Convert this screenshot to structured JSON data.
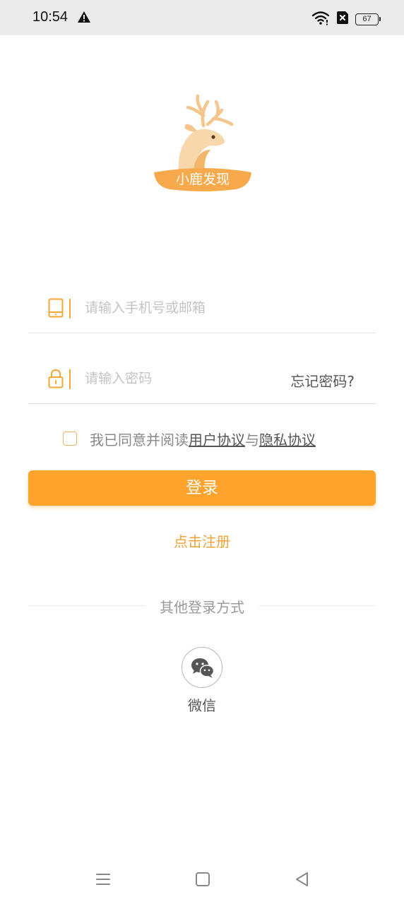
{
  "status_bar": {
    "time": "10:54",
    "battery": "67",
    "icons": [
      "alert-icon",
      "wifi-icon",
      "no-sim-icon",
      "battery-icon"
    ]
  },
  "brand": {
    "logo_text": "小鹿发现",
    "logo_colors": {
      "deer": "#f5c58c",
      "banner": "#f7a94b"
    }
  },
  "login_form": {
    "phone_placeholder": "请输入手机号或邮箱",
    "phone_value": "",
    "password_placeholder": "请输入密码",
    "password_value": "",
    "forgot_label": "忘记密码?",
    "agreement_prefix": "我已同意并阅读",
    "user_agreement": "用户协议",
    "agreement_and": "与",
    "privacy_policy": "隐私协议",
    "agreement_checked": false,
    "login_label": "登录",
    "register_label": "点击注册"
  },
  "other_login": {
    "title": "其他登录方式",
    "wechat_label": "微信"
  },
  "nav_bar": {
    "icons": [
      "menu-icon",
      "home-icon",
      "back-icon"
    ]
  },
  "colors": {
    "accent": "#fea42d",
    "accent_text": "#f0a236",
    "separator": "#f4a636",
    "status_bar_bg": "#ebebeb"
  }
}
